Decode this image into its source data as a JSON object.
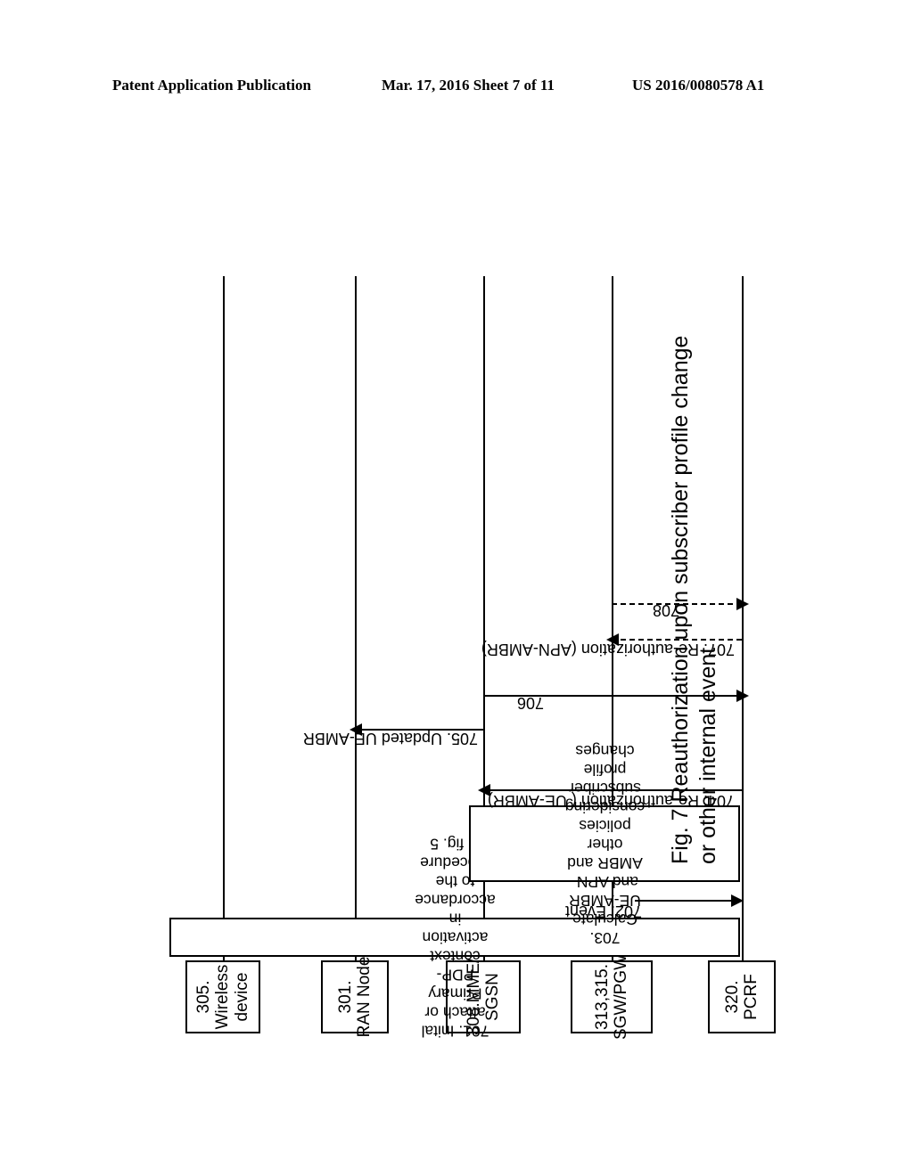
{
  "header": {
    "left": "Patent Application Publication",
    "middle": "Mar. 17, 2016  Sheet 7 of 11",
    "right": "US 2016/0080578 A1"
  },
  "figure": {
    "caption": "Fig. 7 Reauthorization upon subscriber profile change\nor other internal event"
  },
  "diagram": {
    "nodes": [
      {
        "id": "wireless-device",
        "line1": "305.",
        "line2": "Wireless",
        "line3": "device"
      },
      {
        "id": "ran-node",
        "line1": "301.",
        "line2": "RAN Node",
        "line3": ""
      },
      {
        "id": "mme-sgsn",
        "line1": "308.MME/",
        "line2": "SGSN",
        "line3": ""
      },
      {
        "id": "sgw-pgw",
        "line1": "313,315.",
        "line2": "SGW/PGW",
        "line3": ""
      },
      {
        "id": "pcrf",
        "line1": "320.",
        "line2": "PCRF",
        "line3": ""
      }
    ],
    "processes": [
      {
        "id": "step-701",
        "text": "701. Inital attach or Primary PDP-context activation in accordance to the procedure in fig. 5"
      },
      {
        "id": "step-703",
        "text": "703. Calculate UE-AMBR and APN-AMBR and other policies considering subscriber profile changes"
      }
    ],
    "messages": [
      {
        "id": "step-702",
        "label": "702. Event"
      },
      {
        "id": "step-704",
        "label": "704. Re-authorization ( UE-AMBR)"
      },
      {
        "id": "step-705",
        "label": "705. Updated UE-AMBR"
      },
      {
        "id": "step-706",
        "label": "706"
      },
      {
        "id": "step-707",
        "label": "707. Re-authorization (APN-AMBR)"
      },
      {
        "id": "step-708",
        "label": "708"
      }
    ]
  }
}
